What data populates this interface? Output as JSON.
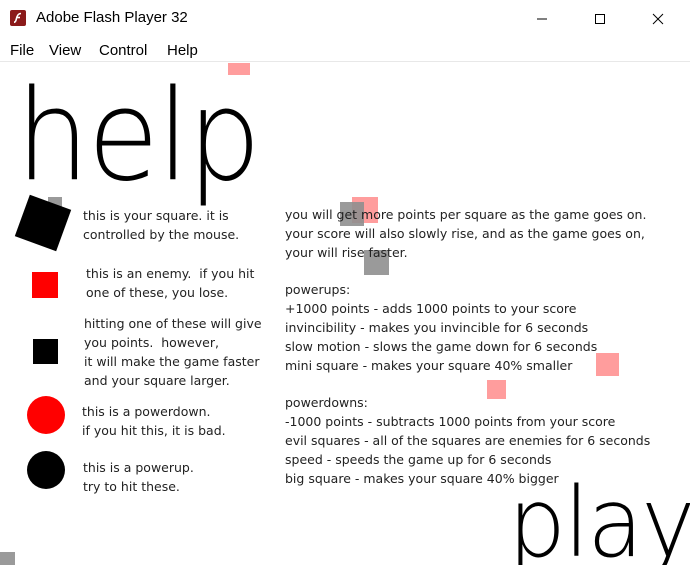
{
  "window": {
    "title": "Adobe Flash Player 32",
    "icon": "flash-player-icon"
  },
  "menu": [
    "File",
    "View",
    "Control",
    "Help"
  ],
  "game": {
    "heading": "help",
    "play_label": "play",
    "legend": [
      {
        "icon": "player-square",
        "lines": "this is your square. it is\ncontrolled by the mouse."
      },
      {
        "icon": "enemy-square",
        "lines": "this is an enemy.  if you hit\none of these, you lose."
      },
      {
        "icon": "points-square",
        "lines": "hitting one of these will give\nyou points.  however,\nit will make the game faster\nand your square larger."
      },
      {
        "icon": "powerdown-circle",
        "lines": "this is a powerdown.\nif you hit this, it is bad."
      },
      {
        "icon": "powerup-circle",
        "lines": "this is a powerup.\ntry to hit these."
      }
    ],
    "intro": "you will get more points per square as the game goes on.\nyour score will also slowly rise, and as the game goes on,\nyour will rise faster.",
    "powerups": "powerups:\n+1000 points - adds 1000 points to your score\ninvincibility - makes you invincible for 6 seconds\nslow motion - slows the game down for 6 seconds\nmini square - makes your square 40% smaller",
    "powerdowns": "powerdowns:\n-1000 points - subtracts 1000 points from your score\nevil squares - all of the squares are enemies for 6 seconds\nspeed - speeds the game up for 6 seconds\nbig square - makes your square 40% bigger"
  },
  "colors": {
    "enemy": "#ff0000",
    "faded_enemy": "#ff9d9d",
    "faded_gray": "#8f8f8f",
    "player": "#000000"
  }
}
